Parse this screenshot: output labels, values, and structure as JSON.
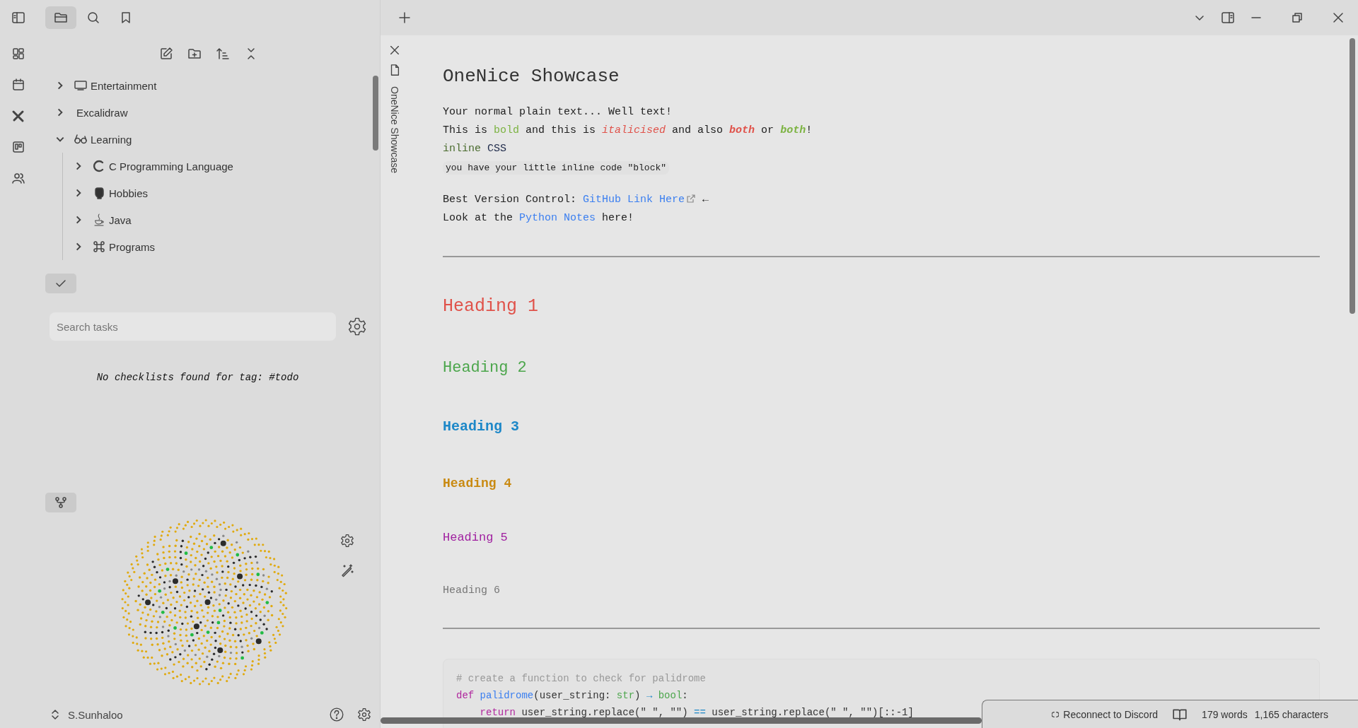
{
  "sidebar_tabs": [
    {
      "selected": true
    },
    {
      "selected": false
    },
    {
      "selected": false
    }
  ],
  "file_tree": [
    {
      "label": "Entertainment",
      "kind": "monitor",
      "expanded": false
    },
    {
      "label": "Excalidraw",
      "kind": "plain",
      "expanded": false
    },
    {
      "label": "Learning",
      "kind": "glasses",
      "expanded": true,
      "children": [
        {
          "label": "C Programming Language",
          "kind": "letter",
          "expanded": false
        },
        {
          "label": "Hobbies",
          "kind": "fist",
          "expanded": false
        },
        {
          "label": "Java",
          "kind": "cup",
          "expanded": false
        },
        {
          "label": "Programs",
          "kind": "command",
          "expanded": false
        }
      ]
    }
  ],
  "tasks": {
    "search": {
      "placeholder": "Search tasks"
    },
    "message": "No checklists found for tag: #todo"
  },
  "vault": {
    "name": "S.Sunhaloo"
  },
  "tab": {
    "title": "OneNice Showcase"
  },
  "note": {
    "title": "OneNice Showcase",
    "paragraphs": [
      {
        "lines": [
          {
            "kind": "text",
            "segments": [
              {
                "text": "Your normal plain text... Well text!",
                "kind": "plain"
              }
            ]
          },
          {
            "kind": "text",
            "segments": [
              {
                "text": "This is ",
                "kind": "plain"
              },
              {
                "text": "bold",
                "kind": "bold"
              },
              {
                "text": " and this is ",
                "kind": "plain"
              },
              {
                "text": "italicised",
                "kind": "italic"
              },
              {
                "text": " and also ",
                "kind": "plain"
              },
              {
                "text": "both",
                "kind": "bolditalic"
              },
              {
                "text": " or ",
                "kind": "plain"
              },
              {
                "text": "both",
                "kind": "italicbold"
              },
              {
                "text": "!",
                "kind": "plain"
              }
            ]
          },
          {
            "kind": "text",
            "segments": [
              {
                "text": "inline",
                "kind": "cssgreen"
              },
              {
                "text": " CSS",
                "kind": "cssnavy"
              }
            ]
          },
          {
            "kind": "code",
            "text": "you have your little inline code \"block\""
          }
        ]
      },
      {
        "lines": [
          {
            "kind": "text",
            "segments": [
              {
                "text": "Best Version Control: ",
                "kind": "plain"
              },
              {
                "text": "GitHub Link Here",
                "kind": "external"
              },
              {
                "text": " ←",
                "kind": "plain"
              }
            ]
          },
          {
            "kind": "text",
            "segments": [
              {
                "text": "Look at the ",
                "kind": "plain"
              },
              {
                "text": "Python Notes",
                "kind": "link"
              },
              {
                "text": " here!",
                "kind": "plain"
              }
            ]
          }
        ]
      }
    ],
    "sections": [
      {
        "kind": "rule"
      },
      {
        "kind": "h1",
        "text": "Heading 1"
      },
      {
        "kind": "h2",
        "text": "Heading 2"
      },
      {
        "kind": "h3",
        "text": "Heading 3"
      },
      {
        "kind": "h4",
        "text": "Heading 4"
      },
      {
        "kind": "h5",
        "text": "Heading 5"
      },
      {
        "kind": "h6",
        "text": "Heading 6"
      },
      {
        "kind": "rule"
      },
      {
        "kind": "code",
        "lines": [
          [
            {
              "text": "# create a function to check for palidrome",
              "kind": "comment"
            }
          ],
          [
            {
              "text": "def ",
              "kind": "keyword"
            },
            {
              "text": "palidrome",
              "kind": "function"
            },
            {
              "text": "(user_string: ",
              "kind": "plain"
            },
            {
              "text": "str",
              "kind": "type"
            },
            {
              "text": ") ",
              "kind": "plain"
            },
            {
              "text": "→",
              "kind": "operator"
            },
            {
              "text": " bool",
              "kind": "type"
            },
            {
              "text": ":",
              "kind": "plain"
            }
          ],
          [
            {
              "text": "    return ",
              "kind": "keyword"
            },
            {
              "text": "user_string.replace(\" \", \"\") ",
              "kind": "plain"
            },
            {
              "text": "==",
              "kind": "operator"
            },
            {
              "text": " user_string.replace(\" \", \"\")[::-1]",
              "kind": "plain"
            }
          ]
        ]
      }
    ]
  },
  "status_bar": {
    "discord": "Reconnect to Discord",
    "words": "179 words",
    "characters": "1,165 characters"
  }
}
